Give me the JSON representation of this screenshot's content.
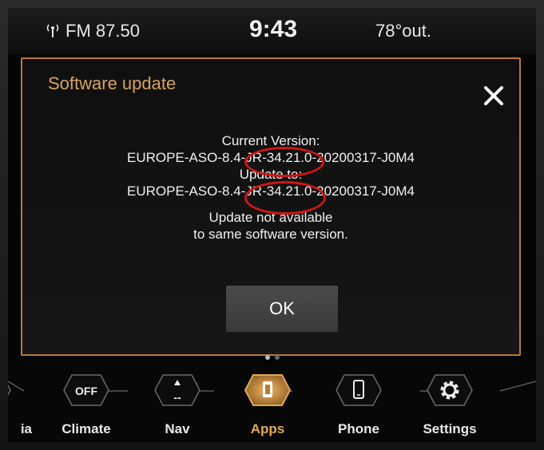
{
  "status": {
    "radio": "FM 87.50",
    "time": "9:43",
    "temp": "78°out."
  },
  "dialog": {
    "title": "Software update",
    "current_label": "Current Version:",
    "current_version": "EUROPE-ASO-8.4-JR-34.21.0-20200317-J0M4",
    "update_label": "Update to:",
    "update_version": "EUROPE-ASO-8.4-JR-34.21.0-20200317-J0M4",
    "note_line1": "Update not available",
    "note_line2": "to same software version.",
    "ok_label": "OK"
  },
  "nav": {
    "items": [
      {
        "label": "ia",
        "inner": ""
      },
      {
        "label": "Climate",
        "inner": "OFF"
      },
      {
        "label": "Nav",
        "inner": "--"
      },
      {
        "label": "Apps",
        "inner": ""
      },
      {
        "label": "Phone",
        "inner": ""
      },
      {
        "label": "Settings",
        "inner": ""
      }
    ],
    "active": "Apps"
  },
  "colors": {
    "accent": "#d8a35c",
    "frame": "#b67a3a",
    "highlight": "#d01616"
  }
}
